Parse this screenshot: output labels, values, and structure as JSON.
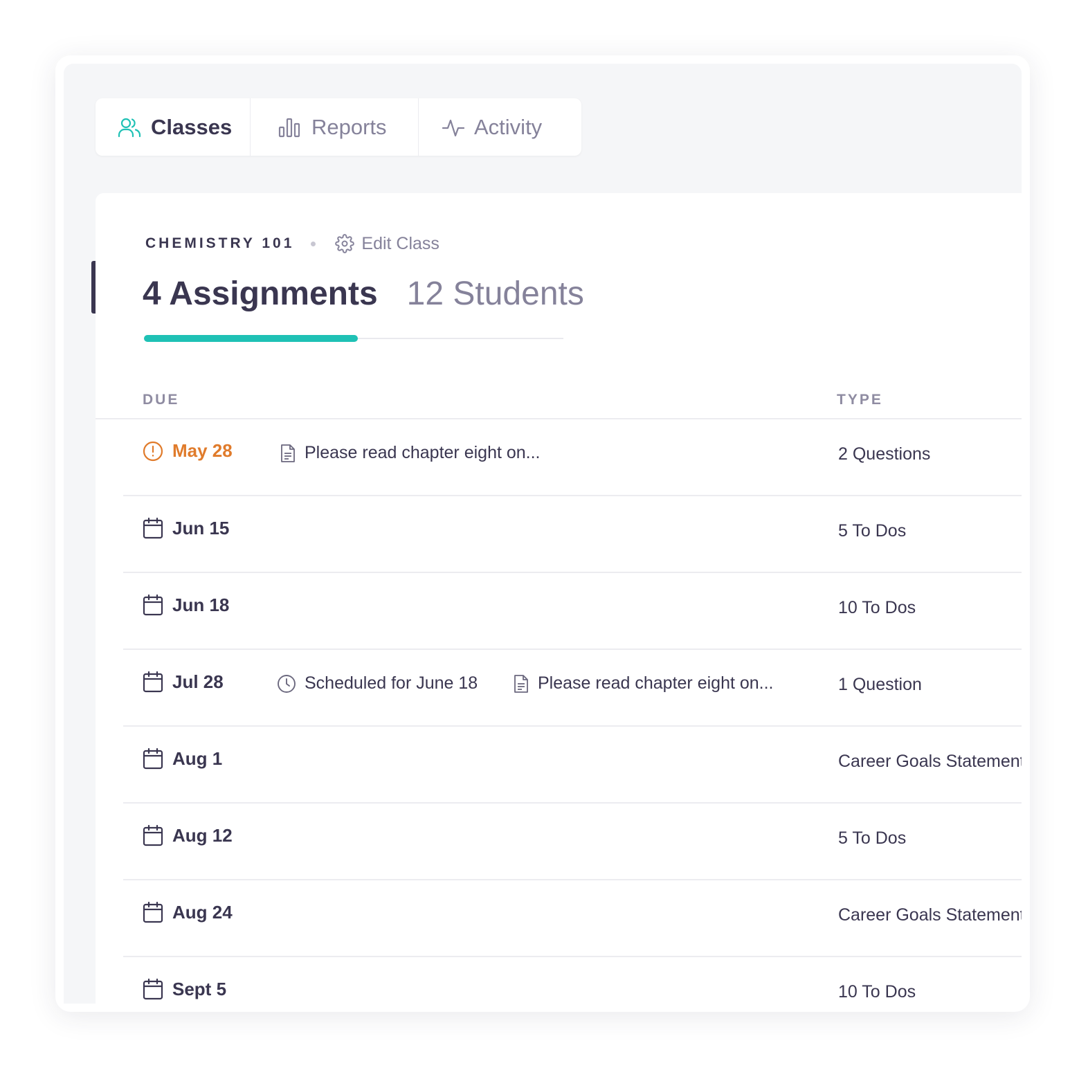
{
  "tabs": [
    {
      "label": "Classes",
      "icon": "users-icon",
      "active": true
    },
    {
      "label": "Reports",
      "icon": "bar-chart-icon",
      "active": false
    },
    {
      "label": "Activity",
      "icon": "activity-icon",
      "active": false
    }
  ],
  "class_header": {
    "name": "CHEMISTRY 101",
    "edit_label": "Edit Class",
    "assignments_tab": "4 Assignments",
    "students_tab": "12 Students"
  },
  "table": {
    "columns": {
      "due": "DUE",
      "type": "TYPE"
    },
    "rows": [
      {
        "date": "May 28",
        "overdue": true,
        "scheduled": "",
        "note": "Please read chapter eight on...",
        "type": "2 Questions"
      },
      {
        "date": "Jun 15",
        "overdue": false,
        "scheduled": "",
        "note": "",
        "type": "5 To Dos"
      },
      {
        "date": "Jun 18",
        "overdue": false,
        "scheduled": "",
        "note": "",
        "type": "10 To Dos"
      },
      {
        "date": "Jul 28",
        "overdue": false,
        "scheduled": "Scheduled for June 18",
        "note": "Please read chapter eight on...",
        "type": "1 Question"
      },
      {
        "date": "Aug 1",
        "overdue": false,
        "scheduled": "",
        "note": "",
        "type": "Career Goals Statement"
      },
      {
        "date": "Aug 12",
        "overdue": false,
        "scheduled": "",
        "note": "",
        "type": "5 To Dos"
      },
      {
        "date": "Aug 24",
        "overdue": false,
        "scheduled": "",
        "note": "",
        "type": "Career Goals Statement"
      },
      {
        "date": "Sept 5",
        "overdue": false,
        "scheduled": "",
        "note": "",
        "type": "10 To Dos"
      }
    ]
  },
  "colors": {
    "accent": "#1fc1b5",
    "overdue": "#e07b2b",
    "text_primary": "#3a3650",
    "text_muted": "#85829a"
  }
}
